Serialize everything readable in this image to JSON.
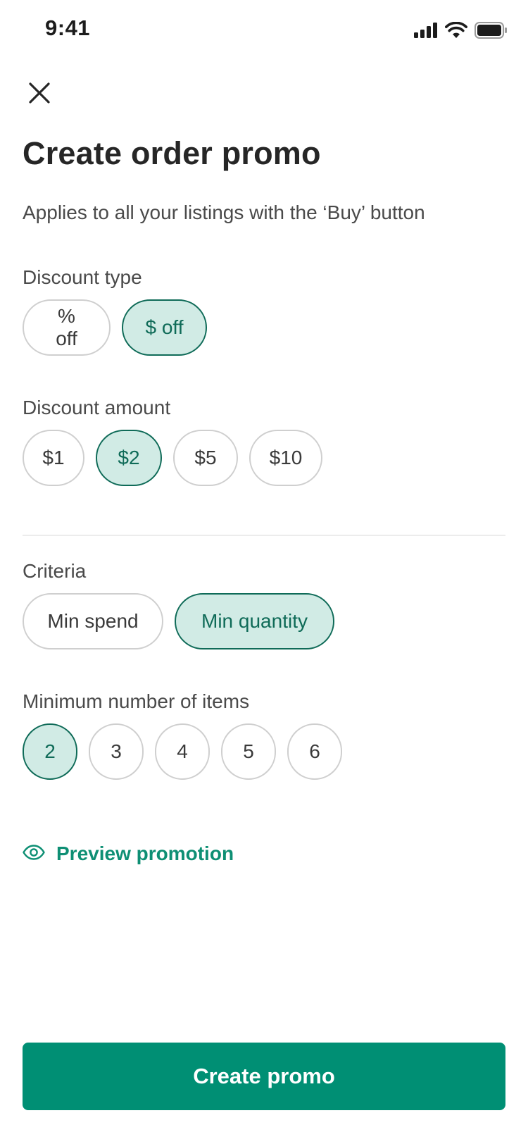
{
  "status_bar": {
    "time": "9:41",
    "icons": [
      "cellular-signal-icon",
      "wifi-icon",
      "battery-icon"
    ]
  },
  "header": {
    "close_icon": "close-icon",
    "title": "Create order promo",
    "subtitle": "Applies to all your listings with the ‘Buy’ button"
  },
  "discount_type": {
    "label": "Discount type",
    "options": [
      {
        "label": "% off",
        "selected": false
      },
      {
        "label": "$ off",
        "selected": true
      }
    ]
  },
  "discount_amount": {
    "label": "Discount amount",
    "options": [
      {
        "label": "$1",
        "selected": false
      },
      {
        "label": "$2",
        "selected": true
      },
      {
        "label": "$5",
        "selected": false
      },
      {
        "label": "$10",
        "selected": false
      }
    ]
  },
  "criteria": {
    "label": "Criteria",
    "options": [
      {
        "label": "Min spend",
        "selected": false
      },
      {
        "label": "Min quantity",
        "selected": true
      }
    ]
  },
  "min_items": {
    "label": "Minimum number of items",
    "options": [
      {
        "label": "2",
        "selected": true
      },
      {
        "label": "3",
        "selected": false
      },
      {
        "label": "4",
        "selected": false
      },
      {
        "label": "5",
        "selected": false
      },
      {
        "label": "6",
        "selected": false
      }
    ]
  },
  "preview": {
    "icon": "eye-icon",
    "label": "Preview promotion"
  },
  "footer": {
    "primary_button_label": "Create promo"
  },
  "colors": {
    "accent": "#008f74",
    "selected_fill": "#d1ebe5",
    "selected_border": "#0f6b58",
    "chip_border": "#cfcfcf"
  }
}
